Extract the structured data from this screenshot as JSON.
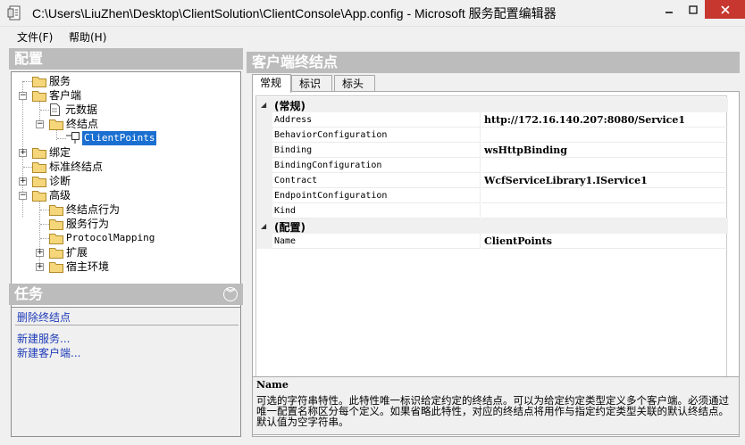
{
  "window": {
    "title": "C:\\Users\\LiuZhen\\Desktop\\ClientSolution\\ClientConsole\\App.config - Microsoft 服务配置编辑器",
    "controls": {
      "minimize": "minimize-icon",
      "maximize": "maximize-icon",
      "close": "close-icon"
    },
    "close_color": "#c7372f"
  },
  "menu": [
    {
      "label": "文件(F)"
    },
    {
      "label": "帮助(H)"
    }
  ],
  "left": {
    "config_header": "配置",
    "tree": [
      {
        "label": "服务"
      },
      {
        "label": "客户端"
      },
      {
        "label": "元数据"
      },
      {
        "label": "终结点"
      },
      {
        "label": "ClientPoints"
      },
      {
        "label": "绑定"
      },
      {
        "label": "标准终结点"
      },
      {
        "label": "诊断"
      },
      {
        "label": "高级"
      },
      {
        "label": "终结点行为"
      },
      {
        "label": "服务行为"
      },
      {
        "label": "ProtocolMapping"
      },
      {
        "label": "扩展"
      },
      {
        "label": "宿主环境"
      }
    ],
    "task_header": "任务",
    "tasks": [
      {
        "label": "删除终结点"
      },
      {
        "label": "新建服务..."
      },
      {
        "label": "新建客户端..."
      }
    ]
  },
  "right": {
    "header": "客户端终结点",
    "tabs": [
      {
        "label": "常规"
      },
      {
        "label": "标识"
      },
      {
        "label": "标头"
      }
    ],
    "grid": {
      "categories": [
        {
          "label": "(常规)",
          "rows": [
            {
              "name": "Address",
              "value": "http://172.16.140.207:8080/Service1"
            },
            {
              "name": "BehaviorConfiguration",
              "value": ""
            },
            {
              "name": "Binding",
              "value": "wsHttpBinding"
            },
            {
              "name": "BindingConfiguration",
              "value": ""
            },
            {
              "name": "Contract",
              "value": "WcfServiceLibrary1.IService1"
            },
            {
              "name": "EndpointConfiguration",
              "value": ""
            },
            {
              "name": "Kind",
              "value": ""
            }
          ]
        },
        {
          "label": "(配置)",
          "rows": [
            {
              "name": "Name",
              "value": "ClientPoints"
            }
          ]
        }
      ]
    },
    "description": {
      "title": "Name",
      "text": "可选的字符串特性。此特性唯一标识给定约定的终结点。可以为给定约定类型定义多个客户端。必须通过唯一配置名称区分每个定义。如果省略此特性，对应的终结点将用作与指定约定类型关联的默认终结点。默认值为空字符串。"
    }
  },
  "colors": {
    "pane_header": "#bcbcbc",
    "selection": "#1a6fd1",
    "link": "#1e3bb8"
  }
}
